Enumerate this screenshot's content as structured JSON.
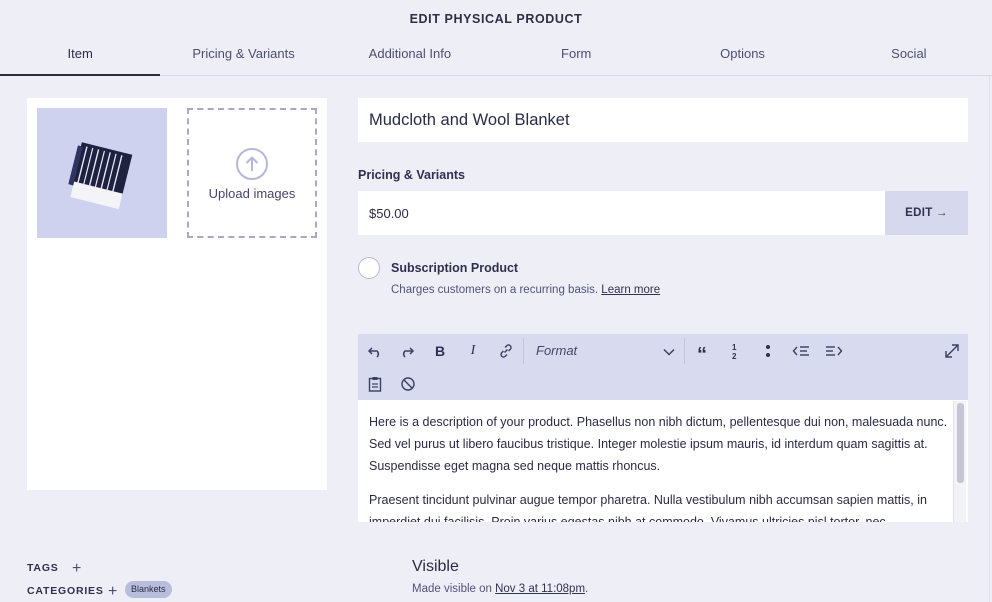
{
  "header": {
    "title": "EDIT PHYSICAL PRODUCT",
    "tabs": [
      {
        "label": "Item",
        "active": true
      },
      {
        "label": "Pricing & Variants"
      },
      {
        "label": "Additional Info"
      },
      {
        "label": "Form"
      },
      {
        "label": "Options"
      },
      {
        "label": "Social"
      }
    ]
  },
  "media": {
    "upload_label": "Upload images",
    "thumbnail_icon": "blanket-product-photo"
  },
  "product": {
    "name": "Mudcloth and Wool Blanket"
  },
  "pricing": {
    "section_label": "Pricing & Variants",
    "price": "$50.00",
    "edit_label": "EDIT →"
  },
  "subscription": {
    "title": "Subscription Product",
    "desc": "Charges customers on a recurring basis.",
    "link": "Learn more",
    "checked": false
  },
  "toolbar": {
    "format_label": "Format",
    "icons": [
      "undo-icon",
      "redo-icon",
      "bold-icon",
      "italic-icon",
      "link-icon",
      "chevron-down-icon",
      "blockquote-icon",
      "numbered-list-icon",
      "bullet-list-icon",
      "outdent-icon",
      "indent-icon",
      "fullscreen-icon",
      "paste-icon",
      "clear-format-icon"
    ]
  },
  "editor": {
    "p1": "Here is a description of your product. Phasellus non nibh dictum, pellentesque dui non, malesuada nunc. Sed vel purus ut libero faucibus tristique. Integer molestie ipsum mauris, id interdum quam sagittis at. Suspendisse eget magna sed neque mattis rhoncus.",
    "p2": "Praesent tincidunt pulvinar augue tempor pharetra. Nulla vestibulum nibh accumsan sapien mattis, in imperdiet dui facilisis. Proin varius egestas nibh at commodo. Vivamus ultricies nisl tortor, nec"
  },
  "meta": {
    "tags_label": "TAGS",
    "categories_label": "CATEGORIES",
    "category_chip": "Blankets",
    "plus": "+"
  },
  "visibility": {
    "title": "Visible",
    "desc_prefix": "Made visible on ",
    "date_link": "Nov 3 at 11:08pm",
    "desc_suffix": "."
  },
  "colors": {
    "background": "#eeeff6",
    "toolbar": "#d8dbf0",
    "accent_button": "#d6d9ee",
    "text": "#27283f"
  }
}
